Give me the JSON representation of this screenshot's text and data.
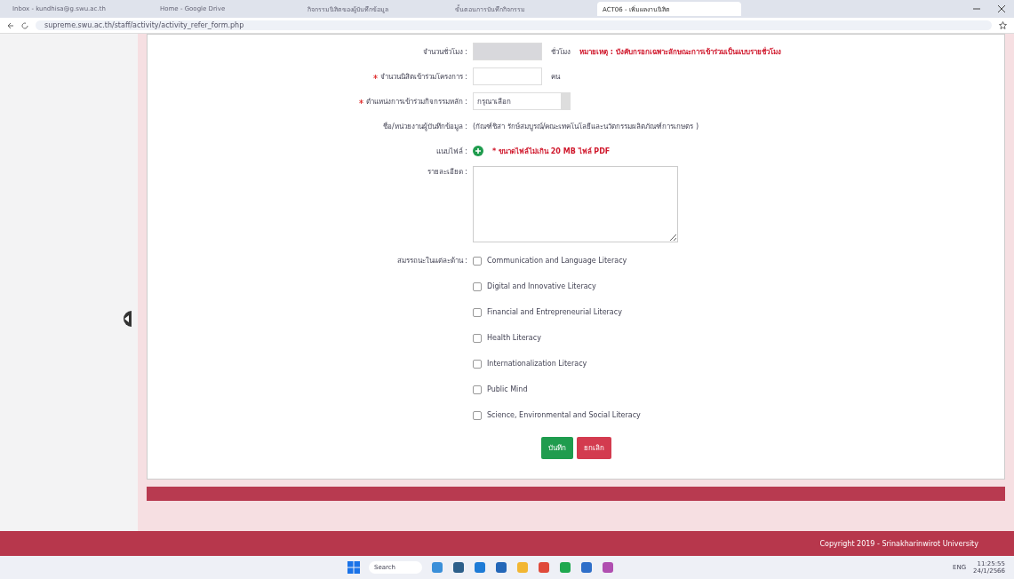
{
  "browser": {
    "tabs": [
      {
        "title": "Inbox - kundhisa@g.swu.ac.th",
        "selected": false
      },
      {
        "title": "Home - Google Drive",
        "selected": false
      },
      {
        "title": "กิจกรรมนิสิตของผู้บันทึกข้อมูล",
        "selected": false
      },
      {
        "title": "ขั้นตอนการบันทึกกิจกรรม",
        "selected": false
      },
      {
        "title": "ACT06 - เพิ่มผลงานนิสิต",
        "selected": true
      }
    ],
    "url": "supreme.swu.ac.th/staff/activity/activity_refer_form.php"
  },
  "form": {
    "hours": {
      "label": "จำนวนชั่วโมง :",
      "unit": "ชั่วโมง",
      "note": "หมายเหตุ : บังคับกรอกเฉพาะลักษณะการเข้าร่วมเป็นแบบรายชั่วโมง",
      "disabled": true
    },
    "students": {
      "label": "จำนวนนิสิตเข้าร่วมโครงการ :",
      "required": true,
      "unit": "คน"
    },
    "position": {
      "label": "ตำแหน่งการเข้าร่วมกิจกรรมหลัก :",
      "required": true,
      "value": "กรุณาเลือก"
    },
    "recorder": {
      "label": "ชื่อ/หน่วยงานผู้บันทึกข้อมูล :",
      "value": "(กัณฑ์ชิสา รักษ์สมบูรณ์/คณะเทคโนโลยีและนวัตกรรมผลิตภัณฑ์การเกษตร )"
    },
    "attachment": {
      "label": "แนบไฟล์ :",
      "note": "* ขนาดไฟล์ไม่เกิน 20 MB ไฟล์ PDF"
    },
    "details": {
      "label": "รายละเอียด :"
    },
    "competencies": {
      "label": "สมรรถนะในแต่ละด้าน :",
      "items": [
        {
          "text": "Communication and Language Literacy",
          "checked": false
        },
        {
          "text": "Digital and Innovative Literacy",
          "checked": false
        },
        {
          "text": "Financial and Entrepreneurial Literacy",
          "checked": false
        },
        {
          "text": "Health Literacy",
          "checked": false
        },
        {
          "text": "Internationalization Literacy",
          "checked": false
        },
        {
          "text": "Public Mind",
          "checked": false
        },
        {
          "text": "Science, Environmental and Social Literacy",
          "checked": false
        }
      ]
    },
    "buttons": [
      {
        "label": "บันทึก",
        "kind": "save"
      },
      {
        "label": "ยกเลิก",
        "kind": "cancel"
      }
    ]
  },
  "footer": "Copyright 2019 - Srinakharinwirot University",
  "taskbar": {
    "search": "Search",
    "time": "11:25:55",
    "date": "24/1/2566",
    "language": "ENG"
  }
}
